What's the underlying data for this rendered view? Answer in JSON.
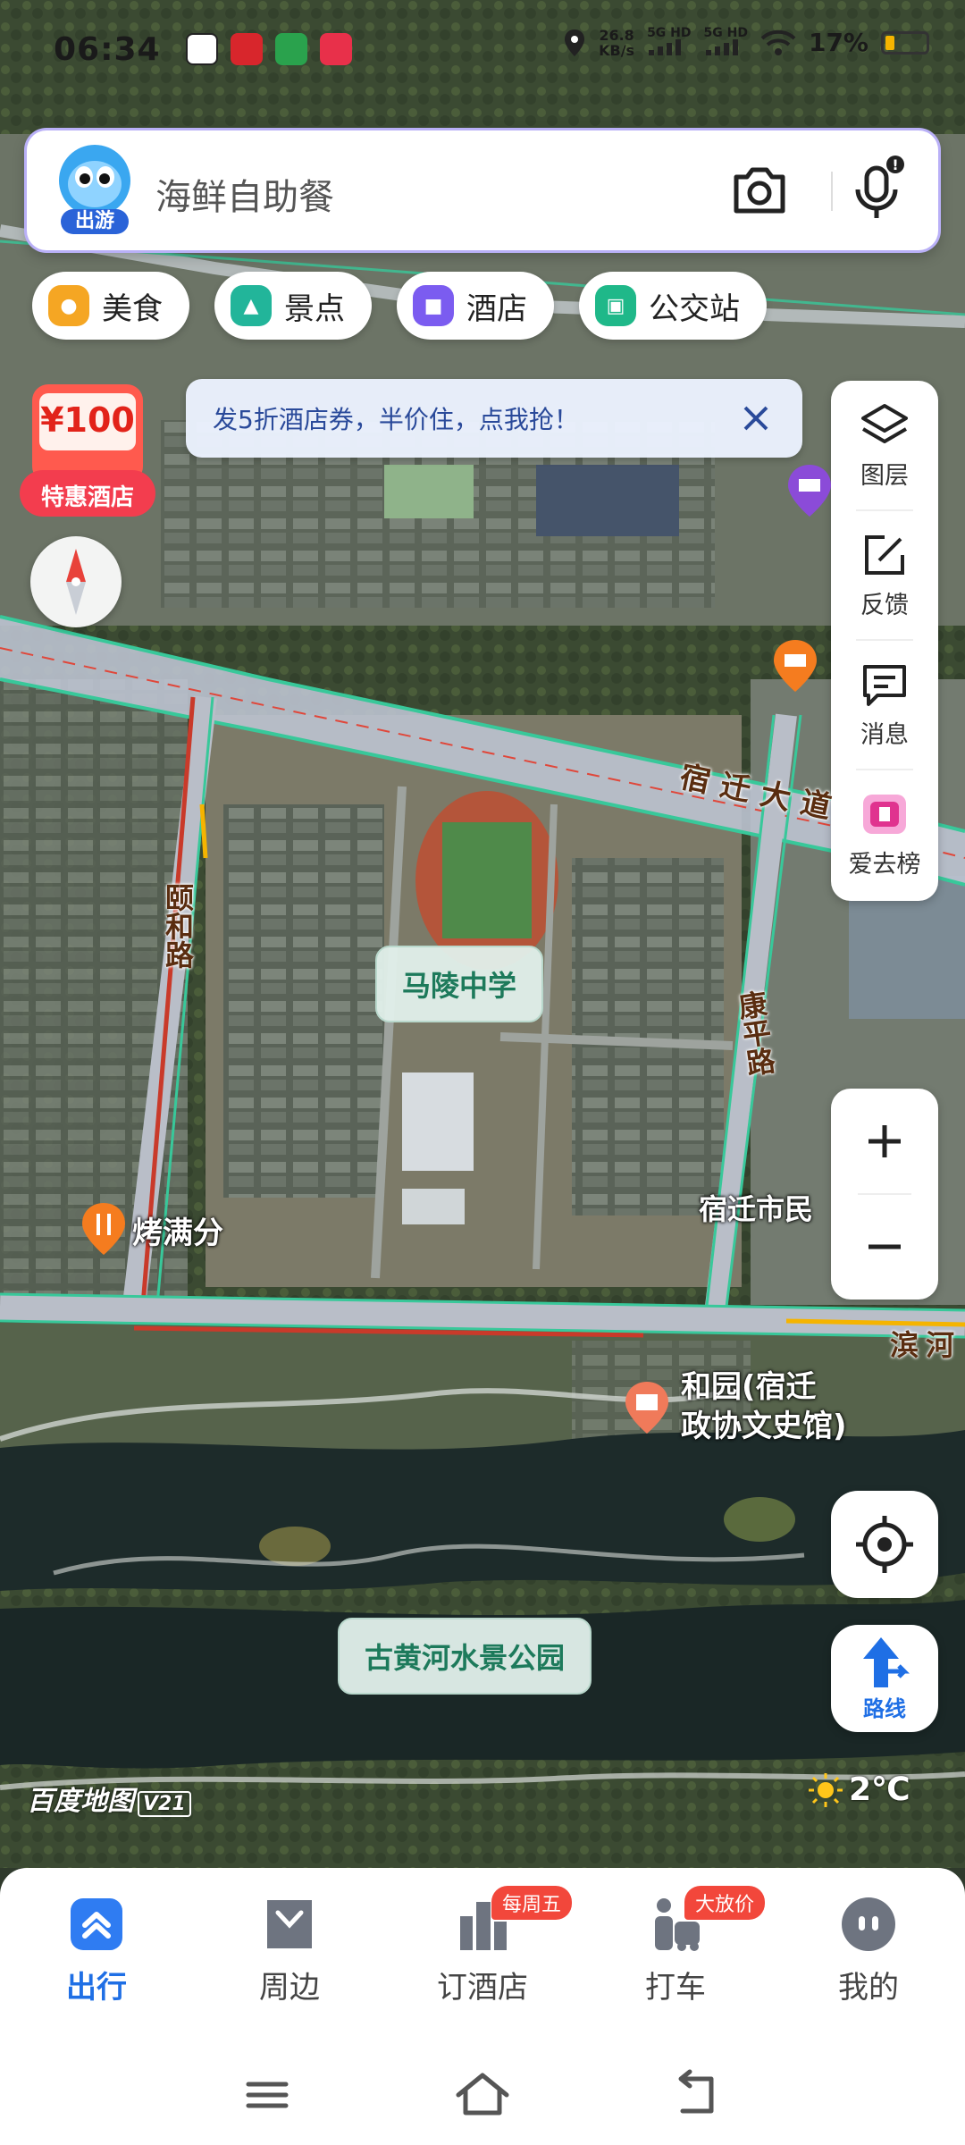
{
  "status_bar": {
    "time": "06:34",
    "net_speed_value": "26.8",
    "net_speed_unit": "KB/s",
    "signal1": "5G HD",
    "signal2": "5G HD",
    "battery": "17%"
  },
  "search": {
    "placeholder": "海鲜自助餐",
    "mascot_label": "出游",
    "icons": [
      "camera-icon",
      "microphone-icon"
    ]
  },
  "chips": [
    {
      "label": "美食",
      "icon": "food-icon",
      "color": "#f5a623"
    },
    {
      "label": "景点",
      "icon": "scenic-icon",
      "color": "#22b59a"
    },
    {
      "label": "酒店",
      "icon": "hotel-icon",
      "color": "#7b5cf0"
    },
    {
      "label": "公交站",
      "icon": "bus-icon",
      "color": "#1fb889"
    }
  ],
  "promo": {
    "text": "发5折酒店券，半价住，点我抢！",
    "badge_amount": "¥100",
    "badge_label": "特惠酒店"
  },
  "right_toolbar": [
    {
      "label": "图层",
      "icon": "layers-icon"
    },
    {
      "label": "反馈",
      "icon": "feedback-icon"
    },
    {
      "label": "消息",
      "icon": "message-icon"
    },
    {
      "label": "爱去榜",
      "icon": "ranking-icon"
    }
  ],
  "route_button": {
    "label": "路线"
  },
  "map": {
    "places": [
      {
        "name": "马陵中学"
      },
      {
        "name": "古黄河水景公园"
      }
    ],
    "pois": [
      {
        "name": "烤满分"
      },
      {
        "name": "和园(宿迁\n政协文史馆)"
      },
      {
        "name": "宿迁市民"
      }
    ],
    "roads": {
      "r1": "宿迁大道",
      "r2": "颐和路",
      "r3": "康平路",
      "r4": "滨河"
    },
    "watermark": "百度地图",
    "watermark_version": "V21",
    "weather": "2℃"
  },
  "bottom_nav": [
    {
      "label": "出行",
      "icon": "travel-icon",
      "active": true
    },
    {
      "label": "周边",
      "icon": "nearby-icon",
      "active": false
    },
    {
      "label": "订酒店",
      "icon": "book-hotel-icon",
      "active": false,
      "badge": "每周五"
    },
    {
      "label": "打车",
      "icon": "taxi-icon",
      "active": false,
      "badge": "大放价"
    },
    {
      "label": "我的",
      "icon": "profile-icon",
      "active": false
    }
  ],
  "colors": {
    "accent": "#1f6fe5",
    "badge_red": "#f2473b",
    "place_text": "#1d7a5b"
  }
}
